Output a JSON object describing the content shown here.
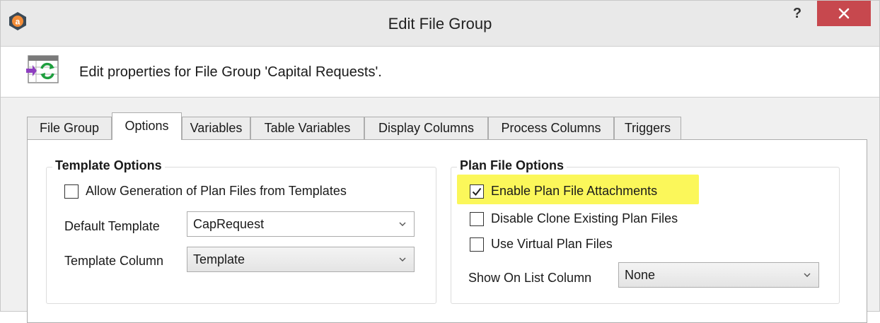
{
  "window": {
    "title": "Edit File Group",
    "help_label": "?",
    "icons": {
      "app": "app-logo-icon",
      "help": "help-icon",
      "close": "close-icon"
    }
  },
  "header": {
    "text": "Edit properties for File Group 'Capital Requests'.",
    "icon": "file-group-refresh-icon"
  },
  "tabs": [
    {
      "label": "File Group",
      "active": false
    },
    {
      "label": "Options",
      "active": true
    },
    {
      "label": "Variables",
      "active": false
    },
    {
      "label": "Table Variables",
      "active": false
    },
    {
      "label": "Display Columns",
      "active": false
    },
    {
      "label": "Process Columns",
      "active": false
    },
    {
      "label": "Triggers",
      "active": false
    }
  ],
  "template_options": {
    "title": "Template Options",
    "allow_generation": {
      "label": "Allow Generation of Plan Files from Templates",
      "checked": false
    },
    "default_template": {
      "label": "Default Template",
      "value": "CapRequest"
    },
    "template_column": {
      "label": "Template Column",
      "value": "Template"
    }
  },
  "plan_file_options": {
    "title": "Plan File Options",
    "enable_attachments": {
      "label": "Enable Plan File Attachments",
      "checked": true,
      "highlighted": true
    },
    "disable_clone": {
      "label": "Disable Clone Existing Plan Files",
      "checked": false
    },
    "virtual_files": {
      "label": "Use Virtual Plan Files",
      "checked": false
    },
    "show_on_list": {
      "label": "Show On List Column",
      "value": "None"
    }
  },
  "colors": {
    "close_button": "#c7484e",
    "highlight": "#fbf75a",
    "tab_border": "#adadad"
  }
}
